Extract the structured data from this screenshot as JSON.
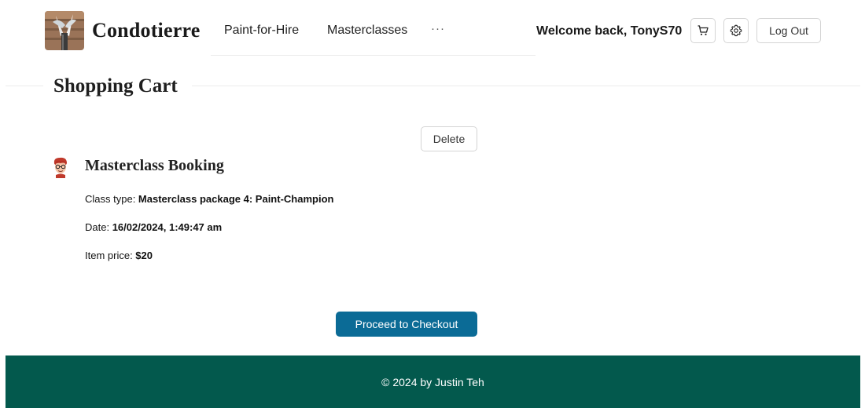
{
  "brand": {
    "name": "Condotierre",
    "logo_icon": "paint-brush-logo-icon"
  },
  "nav": {
    "items": [
      {
        "label": "Paint-for-Hire"
      },
      {
        "label": "Masterclasses"
      }
    ],
    "overflow_label": "···"
  },
  "user": {
    "welcome_text": "Welcome back, TonyS70",
    "cart_icon": "cart-icon",
    "settings_icon": "gear-icon",
    "logout_label": "Log Out"
  },
  "page": {
    "title": "Shopping Cart"
  },
  "cart": {
    "delete_label": "Delete",
    "item": {
      "avatar_icon": "avatar-icon",
      "title": "Masterclass Booking",
      "class_type_label": "Class type: ",
      "class_type_value": "Masterclass package 4: Paint-Champion",
      "date_label": "Date: ",
      "date_value": "16/02/2024, 1:49:47 am",
      "price_label": "Item price: ",
      "price_value": "$20"
    },
    "checkout_label": "Proceed to Checkout"
  },
  "footer": {
    "text": "© 2024 by Justin Teh"
  },
  "colors": {
    "accent": "#0b6b96",
    "footer_bg": "#03594d"
  }
}
